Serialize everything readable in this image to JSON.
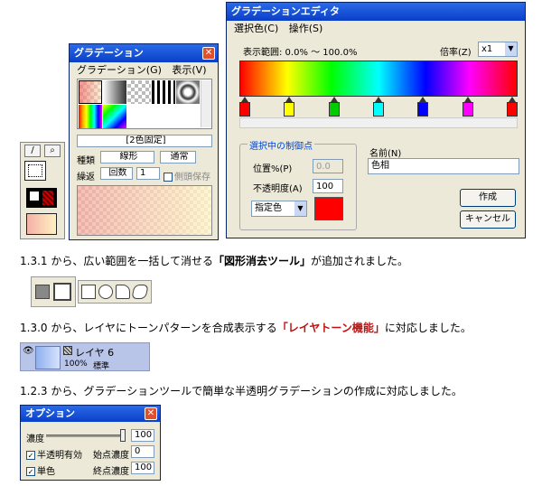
{
  "grad_window": {
    "title": "グラデーション",
    "menu": [
      "グラデーション(G)",
      "表示(V)"
    ],
    "fixed_label": "[2色固定]",
    "type_label": "種類",
    "type_value": "線形",
    "mode_value": "通常",
    "repeat_label": "繰返",
    "repeat_value": "回数",
    "repeat_count": "1",
    "preserve_label": "側頭保存"
  },
  "editor": {
    "title": "グラデーションエディタ",
    "menu": [
      "選択色(C)",
      "操作(S)"
    ],
    "range_label": "表示範囲: 0.0% ～ 100.0%",
    "zoom_label": "倍率(Z)",
    "zoom_value": "x1",
    "group_label": "選択中の制御点",
    "pos_label": "位置%(P)",
    "pos_value": "0.0",
    "opacity_label": "不透明度(A)",
    "opacity_value": "100",
    "color_select": "指定色",
    "name_label": "名前(N)",
    "name_value": "色相",
    "create_btn": "作成",
    "cancel_btn": "キャンセル",
    "stops": [
      "#ff0000",
      "#ffff00",
      "#00cc00",
      "#00ffff",
      "#0000ff",
      "#ff00ff",
      "#ff0000"
    ]
  },
  "notes": {
    "line1_pre": "1.3.1 から、広い範囲を一括して消せる",
    "line1_bold": "「図形消去ツール」",
    "line1_post": "が追加されました。",
    "line2_pre": "1.3.0 から、レイヤにトーンパターンを合成表示する",
    "line2_red": "「レイヤトーン機能」",
    "line2_post": "に対応しました。",
    "line3": "1.2.3 から、グラデーションツールで簡単な半透明グラデーションの作成に対応しました。"
  },
  "layer": {
    "name": "レイヤ 6",
    "opacity": "100%",
    "mode": "標準"
  },
  "option_window": {
    "title": "オプション",
    "density_label": "濃度",
    "density_value": "100",
    "semi_label": "半透明有効",
    "start_label": "始点濃度",
    "start_value": "0",
    "single_label": "単色",
    "end_label": "終点濃度",
    "end_value": "100"
  }
}
